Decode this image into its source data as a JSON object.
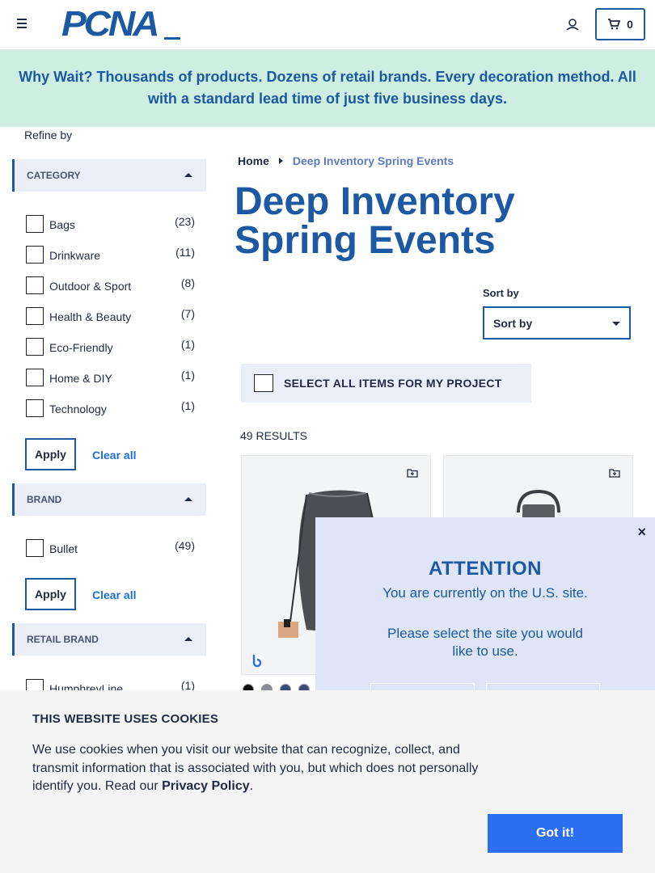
{
  "header": {
    "logo_text": "PCNA",
    "cart_count": "0"
  },
  "banner": {
    "text": "Why Wait? Thousands of products. Dozens of retail brands. Every decoration method. All with a standard lead time of just five business days."
  },
  "sidebar": {
    "refine_label": "Refine by",
    "category": {
      "title": "CATEGORY",
      "items": [
        {
          "label": "Bags",
          "count": "(23)"
        },
        {
          "label": "Drinkware",
          "count": "(11)"
        },
        {
          "label": "Outdoor & Sport",
          "count": "(8)"
        },
        {
          "label": "Health & Beauty",
          "count": "(7)"
        },
        {
          "label": "Eco-Friendly",
          "count": "(1)"
        },
        {
          "label": "Home & DIY",
          "count": "(1)"
        },
        {
          "label": "Technology",
          "count": "(1)"
        }
      ],
      "apply_label": "Apply",
      "clear_label": "Clear all"
    },
    "brand": {
      "title": "BRAND",
      "items": [
        {
          "label": "Bullet",
          "count": "(49)"
        }
      ],
      "apply_label": "Apply",
      "clear_label": "Clear all"
    },
    "retail_brand": {
      "title": "RETAIL BRAND",
      "items": [
        {
          "label": "HumphreyLine",
          "count": "(1)"
        }
      ]
    }
  },
  "breadcrumb": {
    "home": "Home",
    "current": "Deep Inventory Spring Events"
  },
  "page_title": "Deep Inventory Spring Events",
  "sort": {
    "label": "Sort by",
    "selected": "Sort by"
  },
  "select_all_label": "SELECT ALL ITEMS FOR MY PROJECT",
  "results_label": "49 RESULTS",
  "product_swatches": [
    "#111111",
    "#8a8f96",
    "#3a4a7a",
    "#3a4a7a"
  ],
  "modal": {
    "title": "ATTENTION",
    "line1": "You are currently on the U.S. site.",
    "line2": "Please select the site you would like to use.",
    "close": "×"
  },
  "cookie": {
    "title": "THIS WEBSITE USES COOKIES",
    "body": "We use cookies when you visit our website that can recognize, collect, and transmit information that is associated with you, but which does not personally identify you. Read our ",
    "link": "Privacy Policy",
    "tail": ".",
    "button": "Got it!"
  },
  "colors": {
    "brand_blue": "#1d59a3",
    "banner_bg": "#cdeee0",
    "modal_bg": "#dde5f6",
    "cookie_button": "#2d6ff0"
  }
}
